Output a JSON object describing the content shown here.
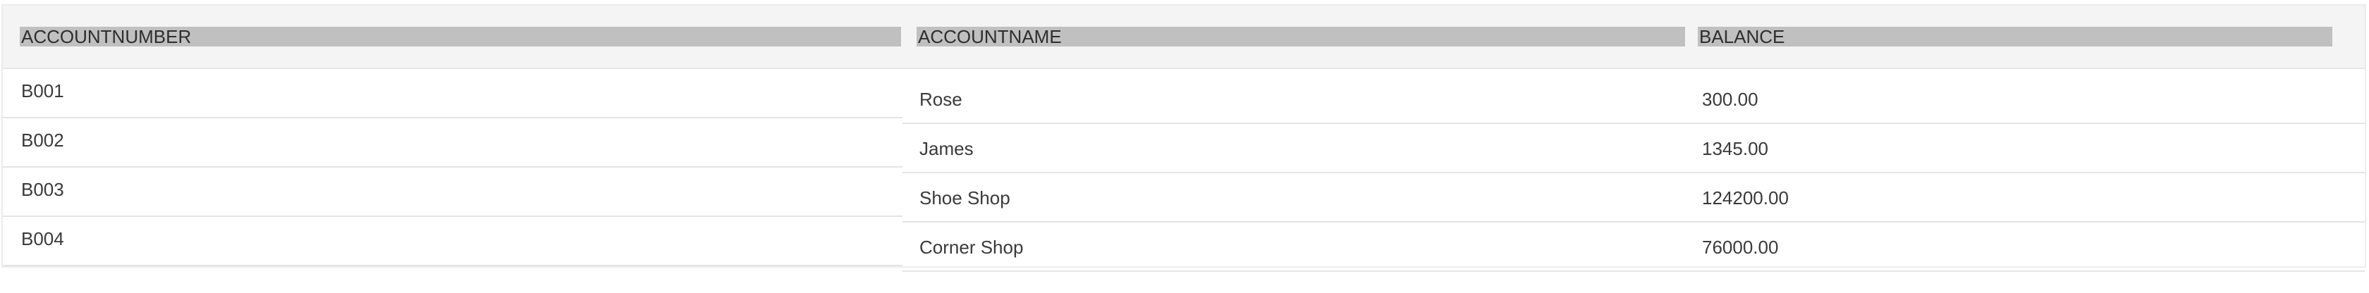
{
  "table": {
    "headers": {
      "account_number": "ACCOUNTNUMBER",
      "account_name": "ACCOUNTNAME",
      "balance": "BALANCE"
    },
    "rows": [
      {
        "account_number": "B001",
        "account_name": "Rose",
        "balance": "300.00"
      },
      {
        "account_number": "B002",
        "account_name": "James",
        "balance": "1345.00"
      },
      {
        "account_number": "B003",
        "account_name": "Shoe Shop",
        "balance": "124200.00"
      },
      {
        "account_number": "B004",
        "account_name": "Corner Shop",
        "balance": "76000.00"
      }
    ]
  }
}
